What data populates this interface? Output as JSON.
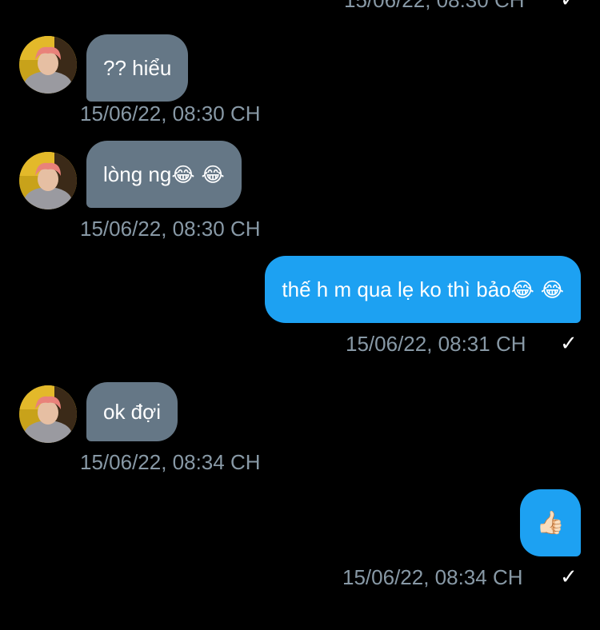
{
  "colors": {
    "background": "#000000",
    "incoming_bubble": "#657786",
    "outgoing_bubble": "#1da1f2",
    "timestamp": "#8899a6"
  },
  "top_partial": {
    "timestamp": "15/06/22, 08:30 CH",
    "check_icon": "✓"
  },
  "messages": [
    {
      "direction": "incoming",
      "text": "?? hiểu",
      "emoji": "",
      "timestamp": "15/06/22, 08:30 CH"
    },
    {
      "direction": "incoming",
      "text": "lòng ng",
      "emoji": "😂 😂",
      "timestamp": "15/06/22, 08:30 CH"
    },
    {
      "direction": "outgoing",
      "text": "thế h m qua lẹ ko thì bảo",
      "emoji": "😂 😂",
      "timestamp": "15/06/22, 08:31 CH",
      "check_icon": "✓"
    },
    {
      "direction": "incoming",
      "text": "ok đợi",
      "emoji": "",
      "timestamp": "15/06/22, 08:34 CH"
    },
    {
      "direction": "outgoing",
      "text": "",
      "emoji": "👍🏻",
      "timestamp": "15/06/22, 08:34 CH",
      "check_icon": "✓"
    }
  ]
}
